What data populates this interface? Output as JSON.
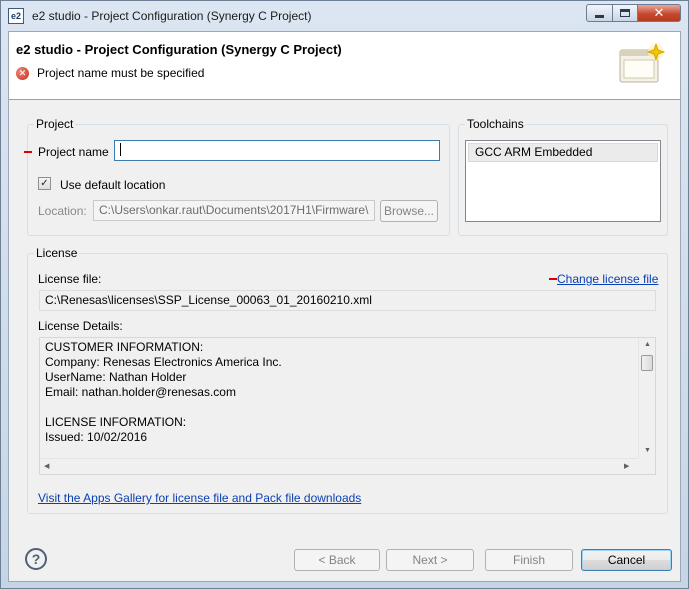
{
  "window": {
    "title": "e2 studio - Project Configuration  (Synergy C Project)",
    "app_icon_text": "e2"
  },
  "header": {
    "title": "e2 studio - Project Configuration  (Synergy C Project)",
    "message": "Project name must be specified",
    "error_icon": "error-circle-icon"
  },
  "project": {
    "group_label": "Project",
    "name_label": "Project name",
    "name_value": "",
    "use_default_label": "Use default location",
    "use_default_checked": true,
    "location_label": "Location:",
    "location_value": "C:\\Users\\onkar.raut\\Documents\\2017H1\\Firmware\\",
    "browse_label": "Browse..."
  },
  "toolchains": {
    "group_label": "Toolchains",
    "items": [
      "GCC ARM Embedded"
    ]
  },
  "license": {
    "group_label": "License",
    "file_label": "License file:",
    "change_link": "Change license file",
    "file_value": "C:\\Renesas\\licenses\\SSP_License_00063_01_20160210.xml",
    "details_label": "License Details:",
    "details_text": "CUSTOMER INFORMATION:\nCompany: Renesas Electronics America Inc.\nUserName: Nathan Holder\nEmail: nathan.holder@renesas.com\n\nLICENSE INFORMATION:\nIssued: 10/02/2016",
    "gallery_link": "Visit the Apps Gallery for license file and Pack file downloads"
  },
  "buttons": {
    "back": "< Back",
    "next": "Next >",
    "finish": "Finish",
    "cancel": "Cancel"
  },
  "colors": {
    "error": "#c42b1c",
    "link": "#0a3fb5",
    "required_marker": "#e00000"
  }
}
